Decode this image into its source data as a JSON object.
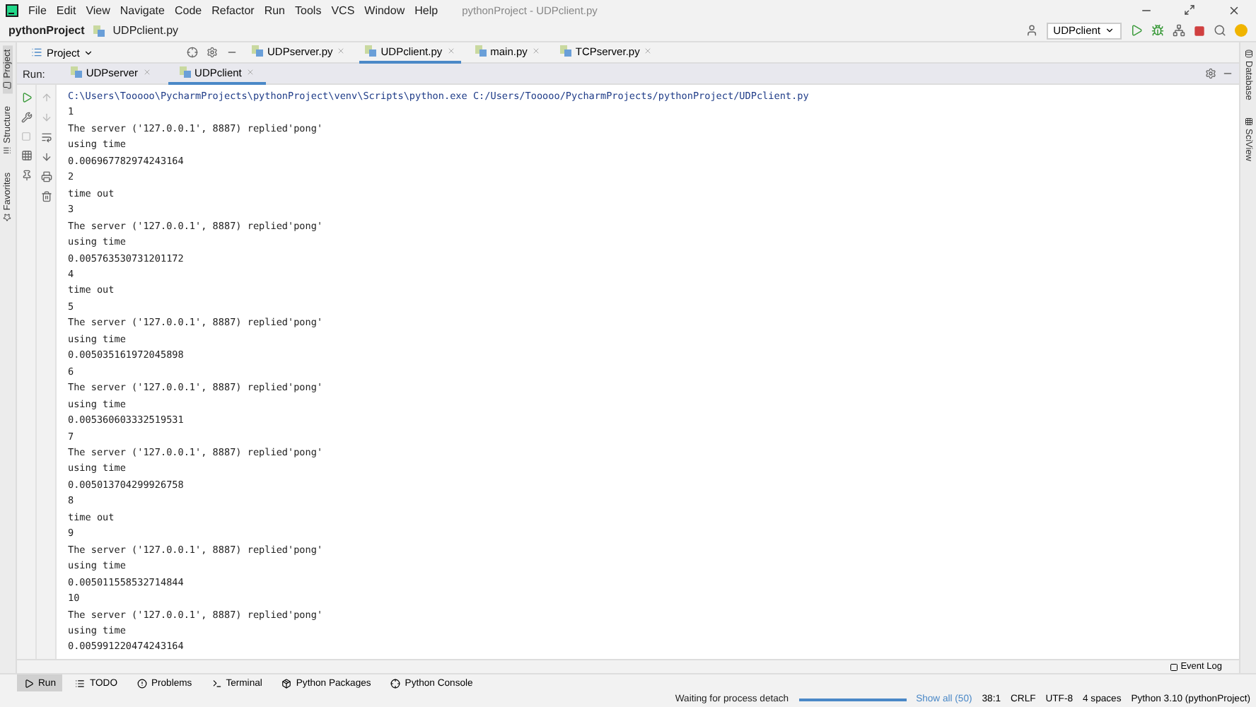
{
  "menu": [
    "File",
    "Edit",
    "View",
    "Navigate",
    "Code",
    "Refactor",
    "Run",
    "Tools",
    "VCS",
    "Window",
    "Help"
  ],
  "window": {
    "title": "pythonProject - UDPclient.py"
  },
  "breadcrumbs": [
    "pythonProject",
    "UDPclient.py"
  ],
  "run_config": "UDPclient",
  "left_strip": [
    {
      "label": "Project",
      "selected": true
    },
    {
      "label": "Structure",
      "selected": false
    },
    {
      "label": "Favorites",
      "selected": false
    }
  ],
  "right_strip": [
    "Database",
    "SciView"
  ],
  "project_pane": {
    "label": "Project"
  },
  "editor_tabs": [
    {
      "label": "UDPserver.py",
      "selected": false
    },
    {
      "label": "UDPclient.py",
      "selected": true
    },
    {
      "label": "main.py",
      "selected": false
    },
    {
      "label": "TCPserver.py",
      "selected": false
    }
  ],
  "run_panel": {
    "label": "Run:",
    "tabs": [
      {
        "label": "UDPserver",
        "selected": false
      },
      {
        "label": "UDPclient",
        "selected": true
      }
    ]
  },
  "console": [
    "C:\\Users\\Tooooo\\PycharmProjects\\pythonProject\\venv\\Scripts\\python.exe C:/Users/Tooooo/PycharmProjects/pythonProject/UDPclient.py",
    "1",
    "The server ('127.0.0.1', 8887) replied'pong'",
    "using time",
    "0.006967782974243164",
    "2",
    "time out",
    "3",
    "The server ('127.0.0.1', 8887) replied'pong'",
    "using time",
    "0.005763530731201172",
    "4",
    "time out",
    "5",
    "The server ('127.0.0.1', 8887) replied'pong'",
    "using time",
    "0.005035161972045898",
    "6",
    "The server ('127.0.0.1', 8887) replied'pong'",
    "using time",
    "0.005360603332519531",
    "7",
    "The server ('127.0.0.1', 8887) replied'pong'",
    "using time",
    "0.005013704299926758",
    "8",
    "time out",
    "9",
    "The server ('127.0.0.1', 8887) replied'pong'",
    "using time",
    "0.005011558532714844",
    "10",
    "The server ('127.0.0.1', 8887) replied'pong'",
    "using time",
    "0.005991220474243164"
  ],
  "bottom_tabs": [
    {
      "label": "Run",
      "selected": true
    },
    {
      "label": "TODO",
      "selected": false
    },
    {
      "label": "Problems",
      "selected": false
    },
    {
      "label": "Terminal",
      "selected": false
    },
    {
      "label": "Python Packages",
      "selected": false
    },
    {
      "label": "Python Console",
      "selected": false
    }
  ],
  "event_log": "Event Log",
  "status_bar": {
    "task": "Waiting for process detach",
    "progress": {
      "level": 1
    },
    "show_all": "Show all (50)",
    "items": [
      "38:1",
      "CRLF",
      "UTF-8",
      "4 spaces",
      "Python 3.10 (pythonProject)"
    ]
  }
}
